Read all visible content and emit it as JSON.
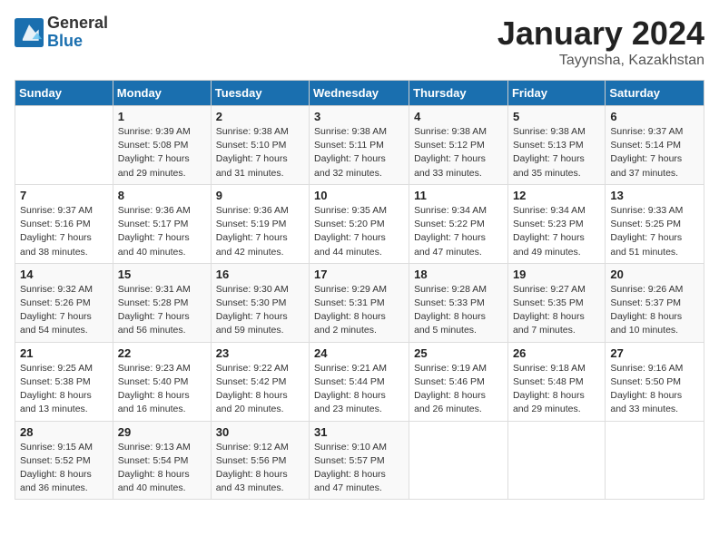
{
  "logo": {
    "general": "General",
    "blue": "Blue"
  },
  "title": "January 2024",
  "subtitle": "Tayynsha, Kazakhstan",
  "days_header": [
    "Sunday",
    "Monday",
    "Tuesday",
    "Wednesday",
    "Thursday",
    "Friday",
    "Saturday"
  ],
  "weeks": [
    [
      {
        "day": "",
        "info": ""
      },
      {
        "day": "1",
        "info": "Sunrise: 9:39 AM\nSunset: 5:08 PM\nDaylight: 7 hours\nand 29 minutes."
      },
      {
        "day": "2",
        "info": "Sunrise: 9:38 AM\nSunset: 5:10 PM\nDaylight: 7 hours\nand 31 minutes."
      },
      {
        "day": "3",
        "info": "Sunrise: 9:38 AM\nSunset: 5:11 PM\nDaylight: 7 hours\nand 32 minutes."
      },
      {
        "day": "4",
        "info": "Sunrise: 9:38 AM\nSunset: 5:12 PM\nDaylight: 7 hours\nand 33 minutes."
      },
      {
        "day": "5",
        "info": "Sunrise: 9:38 AM\nSunset: 5:13 PM\nDaylight: 7 hours\nand 35 minutes."
      },
      {
        "day": "6",
        "info": "Sunrise: 9:37 AM\nSunset: 5:14 PM\nDaylight: 7 hours\nand 37 minutes."
      }
    ],
    [
      {
        "day": "7",
        "info": "Sunrise: 9:37 AM\nSunset: 5:16 PM\nDaylight: 7 hours\nand 38 minutes."
      },
      {
        "day": "8",
        "info": "Sunrise: 9:36 AM\nSunset: 5:17 PM\nDaylight: 7 hours\nand 40 minutes."
      },
      {
        "day": "9",
        "info": "Sunrise: 9:36 AM\nSunset: 5:19 PM\nDaylight: 7 hours\nand 42 minutes."
      },
      {
        "day": "10",
        "info": "Sunrise: 9:35 AM\nSunset: 5:20 PM\nDaylight: 7 hours\nand 44 minutes."
      },
      {
        "day": "11",
        "info": "Sunrise: 9:34 AM\nSunset: 5:22 PM\nDaylight: 7 hours\nand 47 minutes."
      },
      {
        "day": "12",
        "info": "Sunrise: 9:34 AM\nSunset: 5:23 PM\nDaylight: 7 hours\nand 49 minutes."
      },
      {
        "day": "13",
        "info": "Sunrise: 9:33 AM\nSunset: 5:25 PM\nDaylight: 7 hours\nand 51 minutes."
      }
    ],
    [
      {
        "day": "14",
        "info": "Sunrise: 9:32 AM\nSunset: 5:26 PM\nDaylight: 7 hours\nand 54 minutes."
      },
      {
        "day": "15",
        "info": "Sunrise: 9:31 AM\nSunset: 5:28 PM\nDaylight: 7 hours\nand 56 minutes."
      },
      {
        "day": "16",
        "info": "Sunrise: 9:30 AM\nSunset: 5:30 PM\nDaylight: 7 hours\nand 59 minutes."
      },
      {
        "day": "17",
        "info": "Sunrise: 9:29 AM\nSunset: 5:31 PM\nDaylight: 8 hours\nand 2 minutes."
      },
      {
        "day": "18",
        "info": "Sunrise: 9:28 AM\nSunset: 5:33 PM\nDaylight: 8 hours\nand 5 minutes."
      },
      {
        "day": "19",
        "info": "Sunrise: 9:27 AM\nSunset: 5:35 PM\nDaylight: 8 hours\nand 7 minutes."
      },
      {
        "day": "20",
        "info": "Sunrise: 9:26 AM\nSunset: 5:37 PM\nDaylight: 8 hours\nand 10 minutes."
      }
    ],
    [
      {
        "day": "21",
        "info": "Sunrise: 9:25 AM\nSunset: 5:38 PM\nDaylight: 8 hours\nand 13 minutes."
      },
      {
        "day": "22",
        "info": "Sunrise: 9:23 AM\nSunset: 5:40 PM\nDaylight: 8 hours\nand 16 minutes."
      },
      {
        "day": "23",
        "info": "Sunrise: 9:22 AM\nSunset: 5:42 PM\nDaylight: 8 hours\nand 20 minutes."
      },
      {
        "day": "24",
        "info": "Sunrise: 9:21 AM\nSunset: 5:44 PM\nDaylight: 8 hours\nand 23 minutes."
      },
      {
        "day": "25",
        "info": "Sunrise: 9:19 AM\nSunset: 5:46 PM\nDaylight: 8 hours\nand 26 minutes."
      },
      {
        "day": "26",
        "info": "Sunrise: 9:18 AM\nSunset: 5:48 PM\nDaylight: 8 hours\nand 29 minutes."
      },
      {
        "day": "27",
        "info": "Sunrise: 9:16 AM\nSunset: 5:50 PM\nDaylight: 8 hours\nand 33 minutes."
      }
    ],
    [
      {
        "day": "28",
        "info": "Sunrise: 9:15 AM\nSunset: 5:52 PM\nDaylight: 8 hours\nand 36 minutes."
      },
      {
        "day": "29",
        "info": "Sunrise: 9:13 AM\nSunset: 5:54 PM\nDaylight: 8 hours\nand 40 minutes."
      },
      {
        "day": "30",
        "info": "Sunrise: 9:12 AM\nSunset: 5:56 PM\nDaylight: 8 hours\nand 43 minutes."
      },
      {
        "day": "31",
        "info": "Sunrise: 9:10 AM\nSunset: 5:57 PM\nDaylight: 8 hours\nand 47 minutes."
      },
      {
        "day": "",
        "info": ""
      },
      {
        "day": "",
        "info": ""
      },
      {
        "day": "",
        "info": ""
      }
    ]
  ]
}
